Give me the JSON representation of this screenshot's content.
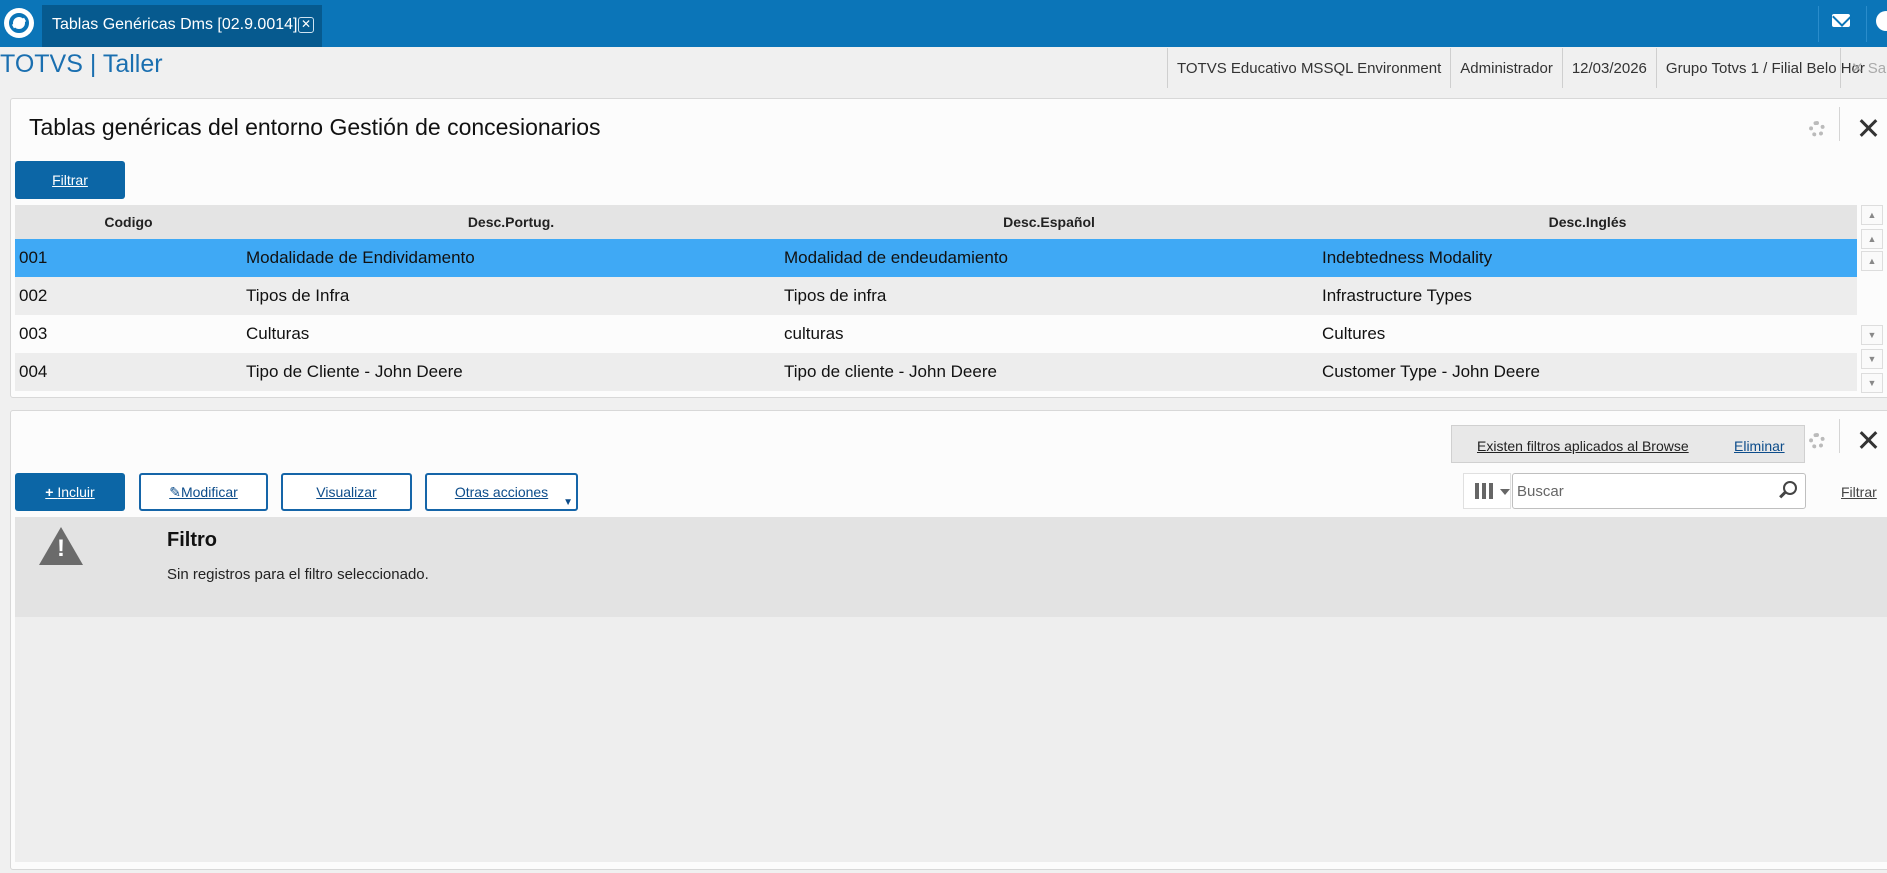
{
  "window": {
    "tab_title": "Tablas Genéricas Dms [02.9.0014]",
    "tab_close": "✕"
  },
  "header": {
    "app_title": "TOTVS | Taller",
    "environment": "TOTVS Educativo MSSQL Environment",
    "user": "Administrador",
    "date": "12/03/2026",
    "branch": "Grupo Totvs 1 / Filial Belo Hor",
    "exit_label": "✕  Sa"
  },
  "top_panel": {
    "title": "Tablas genéricas del entorno Gestión de concesionarios",
    "filter_button": "Filtrar",
    "columns": [
      "Codigo",
      "Desc.Portug.",
      "Desc.Español",
      "Desc.Inglés"
    ],
    "rows": [
      {
        "code": "001",
        "pt": "Modalidade de Endividamento",
        "es": "Modalidad de endeudamiento",
        "en": "Indebtedness Modality",
        "selected": true
      },
      {
        "code": "002",
        "pt": "Tipos de Infra",
        "es": "Tipos de infra",
        "en": "Infrastructure Types"
      },
      {
        "code": "003",
        "pt": "Culturas",
        "es": "culturas",
        "en": "Cultures"
      },
      {
        "code": "004",
        "pt": "Tipo de Cliente - John Deere",
        "es": "Tipo de cliente - John Deere",
        "en": "Customer Type - John Deere"
      }
    ]
  },
  "bottom_panel": {
    "filter_notice": "Existen filtros aplicados al Browse",
    "remove_filter": "Eliminar",
    "buttons": {
      "include": "Incluir",
      "modify": "Modificar",
      "view": "Visualizar",
      "other_actions": "Otras acciones"
    },
    "search_placeholder": "Buscar",
    "filter_link": "Filtrar",
    "message_title": "Filtro",
    "message_text": "Sin registros para el filtro seleccionado."
  },
  "colors": {
    "topbar": "#0b75b8",
    "primary_button": "#0c66a6",
    "selected_row": "#3fa9f5"
  }
}
